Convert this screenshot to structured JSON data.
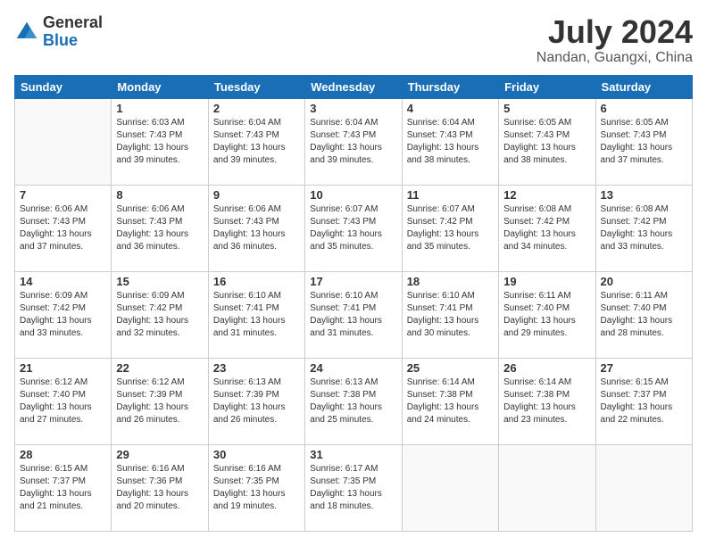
{
  "logo": {
    "line1": "General",
    "line2": "Blue"
  },
  "title": "July 2024",
  "subtitle": "Nandan, Guangxi, China",
  "weekdays": [
    "Sunday",
    "Monday",
    "Tuesday",
    "Wednesday",
    "Thursday",
    "Friday",
    "Saturday"
  ],
  "weeks": [
    [
      {
        "day": "",
        "info": ""
      },
      {
        "day": "1",
        "info": "Sunrise: 6:03 AM\nSunset: 7:43 PM\nDaylight: 13 hours\nand 39 minutes."
      },
      {
        "day": "2",
        "info": "Sunrise: 6:04 AM\nSunset: 7:43 PM\nDaylight: 13 hours\nand 39 minutes."
      },
      {
        "day": "3",
        "info": "Sunrise: 6:04 AM\nSunset: 7:43 PM\nDaylight: 13 hours\nand 39 minutes."
      },
      {
        "day": "4",
        "info": "Sunrise: 6:04 AM\nSunset: 7:43 PM\nDaylight: 13 hours\nand 38 minutes."
      },
      {
        "day": "5",
        "info": "Sunrise: 6:05 AM\nSunset: 7:43 PM\nDaylight: 13 hours\nand 38 minutes."
      },
      {
        "day": "6",
        "info": "Sunrise: 6:05 AM\nSunset: 7:43 PM\nDaylight: 13 hours\nand 37 minutes."
      }
    ],
    [
      {
        "day": "7",
        "info": "Sunrise: 6:06 AM\nSunset: 7:43 PM\nDaylight: 13 hours\nand 37 minutes."
      },
      {
        "day": "8",
        "info": "Sunrise: 6:06 AM\nSunset: 7:43 PM\nDaylight: 13 hours\nand 36 minutes."
      },
      {
        "day": "9",
        "info": "Sunrise: 6:06 AM\nSunset: 7:43 PM\nDaylight: 13 hours\nand 36 minutes."
      },
      {
        "day": "10",
        "info": "Sunrise: 6:07 AM\nSunset: 7:43 PM\nDaylight: 13 hours\nand 35 minutes."
      },
      {
        "day": "11",
        "info": "Sunrise: 6:07 AM\nSunset: 7:42 PM\nDaylight: 13 hours\nand 35 minutes."
      },
      {
        "day": "12",
        "info": "Sunrise: 6:08 AM\nSunset: 7:42 PM\nDaylight: 13 hours\nand 34 minutes."
      },
      {
        "day": "13",
        "info": "Sunrise: 6:08 AM\nSunset: 7:42 PM\nDaylight: 13 hours\nand 33 minutes."
      }
    ],
    [
      {
        "day": "14",
        "info": "Sunrise: 6:09 AM\nSunset: 7:42 PM\nDaylight: 13 hours\nand 33 minutes."
      },
      {
        "day": "15",
        "info": "Sunrise: 6:09 AM\nSunset: 7:42 PM\nDaylight: 13 hours\nand 32 minutes."
      },
      {
        "day": "16",
        "info": "Sunrise: 6:10 AM\nSunset: 7:41 PM\nDaylight: 13 hours\nand 31 minutes."
      },
      {
        "day": "17",
        "info": "Sunrise: 6:10 AM\nSunset: 7:41 PM\nDaylight: 13 hours\nand 31 minutes."
      },
      {
        "day": "18",
        "info": "Sunrise: 6:10 AM\nSunset: 7:41 PM\nDaylight: 13 hours\nand 30 minutes."
      },
      {
        "day": "19",
        "info": "Sunrise: 6:11 AM\nSunset: 7:40 PM\nDaylight: 13 hours\nand 29 minutes."
      },
      {
        "day": "20",
        "info": "Sunrise: 6:11 AM\nSunset: 7:40 PM\nDaylight: 13 hours\nand 28 minutes."
      }
    ],
    [
      {
        "day": "21",
        "info": "Sunrise: 6:12 AM\nSunset: 7:40 PM\nDaylight: 13 hours\nand 27 minutes."
      },
      {
        "day": "22",
        "info": "Sunrise: 6:12 AM\nSunset: 7:39 PM\nDaylight: 13 hours\nand 26 minutes."
      },
      {
        "day": "23",
        "info": "Sunrise: 6:13 AM\nSunset: 7:39 PM\nDaylight: 13 hours\nand 26 minutes."
      },
      {
        "day": "24",
        "info": "Sunrise: 6:13 AM\nSunset: 7:38 PM\nDaylight: 13 hours\nand 25 minutes."
      },
      {
        "day": "25",
        "info": "Sunrise: 6:14 AM\nSunset: 7:38 PM\nDaylight: 13 hours\nand 24 minutes."
      },
      {
        "day": "26",
        "info": "Sunrise: 6:14 AM\nSunset: 7:38 PM\nDaylight: 13 hours\nand 23 minutes."
      },
      {
        "day": "27",
        "info": "Sunrise: 6:15 AM\nSunset: 7:37 PM\nDaylight: 13 hours\nand 22 minutes."
      }
    ],
    [
      {
        "day": "28",
        "info": "Sunrise: 6:15 AM\nSunset: 7:37 PM\nDaylight: 13 hours\nand 21 minutes."
      },
      {
        "day": "29",
        "info": "Sunrise: 6:16 AM\nSunset: 7:36 PM\nDaylight: 13 hours\nand 20 minutes."
      },
      {
        "day": "30",
        "info": "Sunrise: 6:16 AM\nSunset: 7:35 PM\nDaylight: 13 hours\nand 19 minutes."
      },
      {
        "day": "31",
        "info": "Sunrise: 6:17 AM\nSunset: 7:35 PM\nDaylight: 13 hours\nand 18 minutes."
      },
      {
        "day": "",
        "info": ""
      },
      {
        "day": "",
        "info": ""
      },
      {
        "day": "",
        "info": ""
      }
    ]
  ]
}
